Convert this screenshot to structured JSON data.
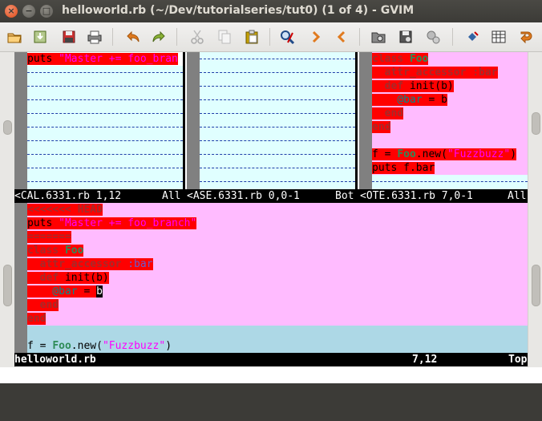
{
  "window": {
    "title": "helloworld.rb (~/Dev/tutorialseries/tut0) (1 of 4) - GVIM",
    "close_glyph": "×",
    "minimize_glyph": "−",
    "maximize_glyph": "□"
  },
  "toolbar": {
    "icons": [
      "open-icon",
      "save-icon",
      "save-all-icon",
      "print-icon",
      "undo-icon",
      "redo-icon",
      "cut-icon",
      "copy-icon",
      "paste-icon",
      "find-replace-icon",
      "find-next-icon",
      "find-prev-icon",
      "load-session-icon",
      "save-session-icon",
      "run-script-icon",
      "make-icon",
      "shell-icon",
      "help-icon"
    ]
  },
  "colors": {
    "conflict_red": "#ff0000",
    "diff_pink": "#ffbbff",
    "diff_cyan": "#e0ffff",
    "diff_blue": "#add8e6",
    "keyword": "#a52a2a",
    "string": "#ff00ff",
    "constant": "#2e8b57"
  },
  "panes": {
    "local": {
      "line1_kw": "puts ",
      "line1_str": "\"Master += foo_bran",
      "status_name": "<CAL.6331.rb 1,12",
      "status_pos": "All"
    },
    "base": {
      "status_name": "<ASE.6331.rb 0,0-1",
      "status_pos": "Bot"
    },
    "remote": {
      "l1_kw": "class ",
      "l1_cls": "Foo",
      "l2": "  attr_accessor :bar",
      "l3_kw": "def ",
      "l3_rest": "init(b)",
      "l4_ivar": "@bar",
      "l4_rest": " = b",
      "l5": "  end",
      "l6": "end",
      "l8_a": "f = ",
      "l8_cls": "Foo",
      "l8_b": ".new(",
      "l8_str": "\"Fuzzbuzz\"",
      "l8_c": ")",
      "l9": "puts f.bar",
      "status_name": "<OTE.6331.rb 7,0-1",
      "status_pos": "All"
    },
    "merged": {
      "l1": "<<<<<<< HEAD",
      "l2_kw": "puts ",
      "l2_str": "\"Master += foo_branch\"",
      "l3": "=======",
      "l4_kw": "class ",
      "l4_cls": "Foo",
      "l5_kw": "  attr_accessor ",
      "l5_sym": ":bar",
      "l6_kw": "  def ",
      "l6_rest": "init(b)",
      "l7_ivar": "    @bar",
      "l7_eq": " = ",
      "l7_cursor": "b",
      "l8": "  end",
      "l9": "end",
      "l11_a": "f = ",
      "l11_cls": "Foo",
      "l11_b": ".new(",
      "l11_str": "\"Fuzzbuzz\"",
      "l11_c": ")",
      "status_name": "helloworld.rb",
      "status_pos": "7,12",
      "status_scroll": "Top"
    }
  }
}
